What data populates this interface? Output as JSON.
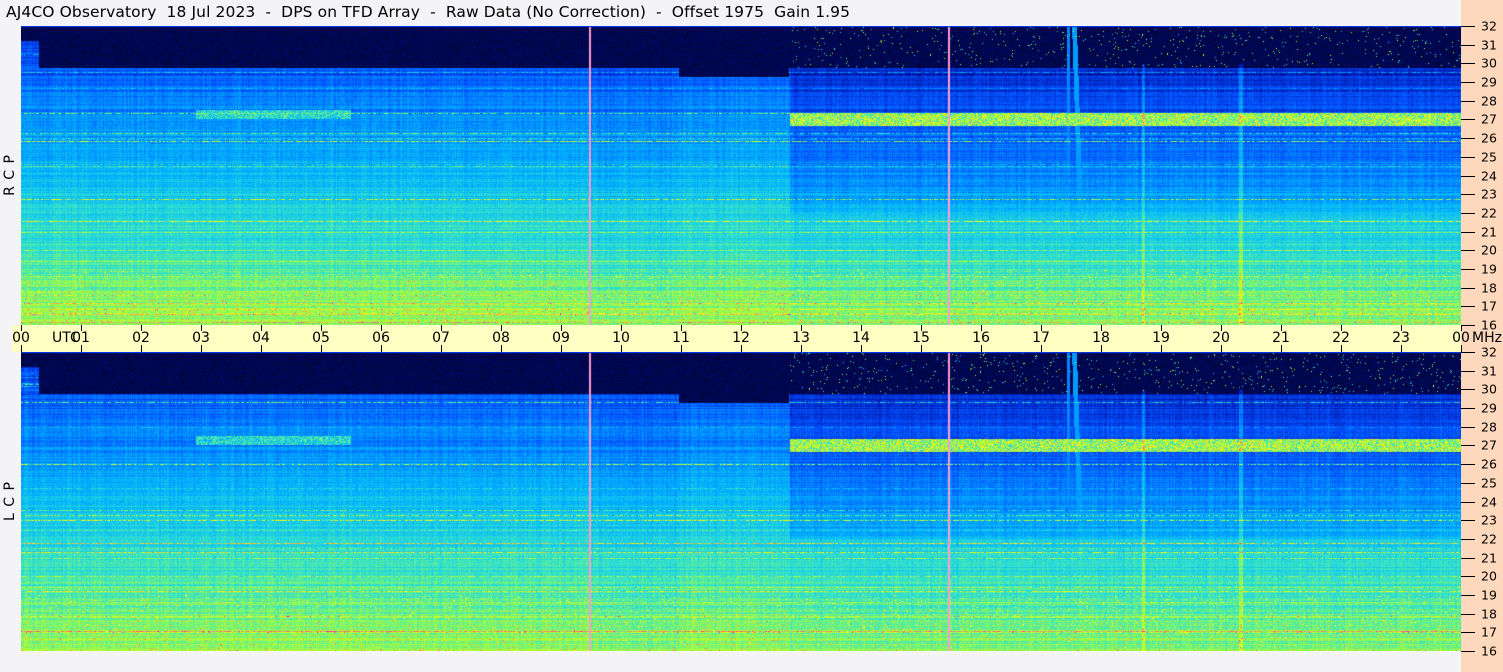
{
  "title": "AJ4CO Observatory  18 Jul 2023  -  DPS on TFD Array  -  Raw Data (No Correction)  -  Offset 1975  Gain 1.95",
  "chart_data": {
    "type": "heatmap",
    "title": "AJ4CO Observatory  18 Jul 2023  -  DPS on TFD Array  -  Raw Data (No Correction)  -  Offset 1975  Gain 1.95",
    "xlabel": "UTC",
    "ylabel": "MHz",
    "x_range": [
      0,
      24
    ],
    "y_range": [
      16,
      32
    ],
    "x_ticks": [
      "00",
      "01",
      "02",
      "03",
      "04",
      "05",
      "06",
      "07",
      "08",
      "09",
      "10",
      "11",
      "12",
      "13",
      "14",
      "15",
      "16",
      "17",
      "18",
      "19",
      "20",
      "21",
      "22",
      "23",
      "00"
    ],
    "y_ticks": [
      "16",
      "17",
      "18",
      "19",
      "20",
      "21",
      "22",
      "23",
      "24",
      "25",
      "26",
      "27",
      "28",
      "29",
      "30",
      "31",
      "32"
    ],
    "x_unit_label": "UTC",
    "y_unit_label": "MHz",
    "panels": [
      {
        "name": "R C P"
      },
      {
        "name": "L C P"
      }
    ],
    "marker_times_utc": [
      9.47,
      15.45
    ],
    "marker_color": "#ff9ad0",
    "features": {
      "noise_floor_cutoff_mhz": 29.8,
      "strong_band_mhz": 27.0,
      "strong_band_start_utc": 12.8,
      "burst_time_utc": 17.65,
      "burst_low_mhz": 22,
      "vertical_interference_utc": [
        20.33,
        18.7
      ],
      "persistent_lines_mhz": [
        21.0,
        17.1,
        17.8,
        18.6,
        19.4,
        20.0
      ]
    },
    "colormap": [
      "#000010",
      "#0010a0",
      "#0050ff",
      "#00b0ff",
      "#30e0d0",
      "#a0ff40",
      "#ffff00",
      "#ff4080",
      "#ff00ff"
    ]
  }
}
